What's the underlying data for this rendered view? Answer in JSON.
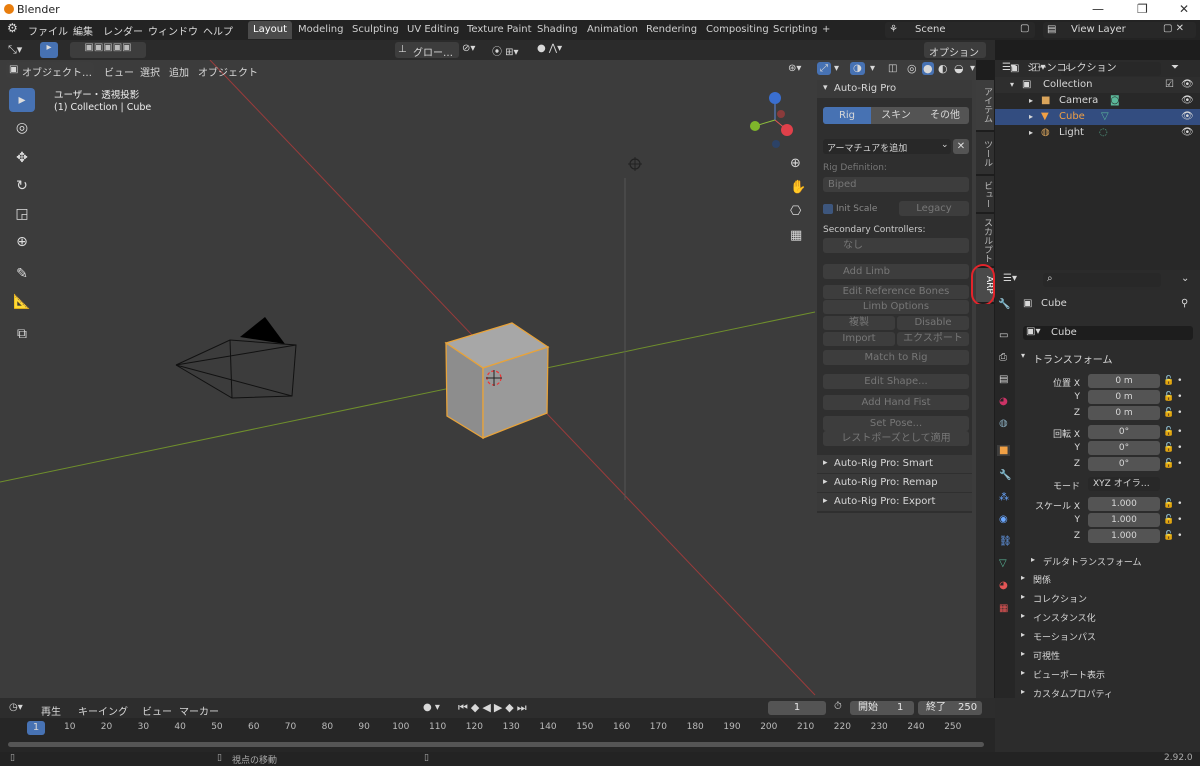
{
  "window": {
    "title": "Blender"
  },
  "menu": [
    "ファイル",
    "編集",
    "レンダー",
    "ウィンドウ",
    "ヘルプ"
  ],
  "workspaces": [
    "Layout",
    "Modeling",
    "Sculpting",
    "UV Editing",
    "Texture Paint",
    "Shading",
    "Animation",
    "Rendering",
    "Compositing",
    "Scripting"
  ],
  "active_workspace": "Layout",
  "scene": "Scene",
  "view_layer": "View Layer",
  "toolbar": {
    "transform_orient": "グロー…",
    "options": "オプション"
  },
  "viewport_header": {
    "mode": "オブジェクト…",
    "items": [
      "ビュー",
      "選択",
      "追加",
      "オブジェクト"
    ]
  },
  "viewport": {
    "view_name": "ユーザー・透視投影",
    "collection_info": "(1) Collection | Cube"
  },
  "arp": {
    "title": "Auto-Rig Pro",
    "tabs": [
      "Rig",
      "スキン",
      "その他"
    ],
    "add_armature": "アーマチュアを追加",
    "rig_def_label": "Rig Definition:",
    "rig_def_value": "Biped",
    "init_scale": "Init Scale",
    "legacy": "Legacy",
    "secondary_label": "Secondary Controllers:",
    "secondary_value": "なし",
    "add_limb": "Add Limb",
    "edit_ref": "Edit Reference Bones",
    "limb_options": "Limb Options",
    "duplicate": "複製",
    "disable": "Disable",
    "import": "Import",
    "export": "エクスポート",
    "match_to_rig": "Match to Rig",
    "edit_shape": "Edit Shape...",
    "add_hand_fist": "Add Hand Fist",
    "set_pose": "Set Pose...",
    "apply_rest": "レストポーズとして適用",
    "smart": "Auto-Rig Pro: Smart",
    "remap": "Auto-Rig Pro: Remap",
    "export_panel": "Auto-Rig Pro: Export"
  },
  "side_tabs": [
    "アイテム",
    "ツール",
    "ビュー",
    "スカルプト",
    "ARP"
  ],
  "outliner": {
    "root": "シーンコレクション",
    "collection": "Collection",
    "items": [
      "Camera",
      "Cube",
      "Light"
    ]
  },
  "properties": {
    "object_name": "Cube",
    "object_field": "Cube",
    "transform": "トランスフォーム",
    "loc_label": "位置 X",
    "rot_label": "回転 X",
    "scale_label": "スケール X",
    "y": "Y",
    "z": "Z",
    "loc": [
      "0 m",
      "0 m",
      "0 m"
    ],
    "rot": [
      "0°",
      "0°",
      "0°"
    ],
    "mode_label": "モード",
    "mode": "XYZ オイラ…",
    "scale": [
      "1.000",
      "1.000",
      "1.000"
    ],
    "delta": "デルタトランスフォーム",
    "sections": [
      "関係",
      "コレクション",
      "インスタンス化",
      "モーションパス",
      "可視性",
      "ビューポート表示",
      "カスタムプロパティ"
    ]
  },
  "timeline": {
    "menus": [
      "再生",
      "キーイング",
      "ビュー",
      "マーカー"
    ],
    "current": "1",
    "start_label": "開始",
    "start": "1",
    "end_label": "終了",
    "end": "250",
    "frame_marker": "1",
    "ticks": [
      "10",
      "20",
      "30",
      "40",
      "50",
      "60",
      "70",
      "80",
      "90",
      "100",
      "110",
      "120",
      "130",
      "140",
      "150",
      "160",
      "170",
      "180",
      "190",
      "200",
      "210",
      "220",
      "230",
      "240",
      "250"
    ]
  },
  "status": {
    "hint": "視点の移動",
    "version": "2.92.0"
  },
  "colors": {
    "accent": "#4772b3",
    "selection": "#e8a33a",
    "highlight_circle": "#e3242b"
  }
}
